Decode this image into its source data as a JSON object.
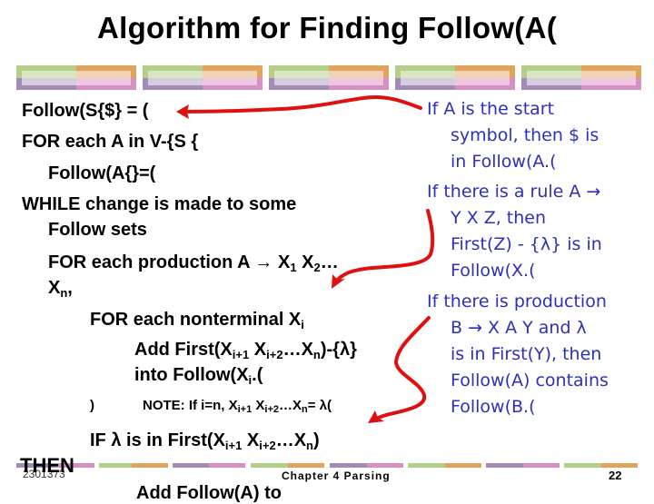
{
  "slide": {
    "title": "Algorithm for Finding Follow(A(",
    "colors": {
      "green": "#b4cf8a",
      "orange": "#e0a45e",
      "purple": "#a08cb4",
      "pink": "#d690c4",
      "arrow_red": "#e01010",
      "note_blue": "#2e30b8"
    },
    "algorithm": {
      "l1": "Follow(S{$} = (",
      "l2": "FOR each A in V-{S {",
      "l3": "Follow(A{}=(",
      "l4": "WHILE change is made to some",
      "l5": "Follow sets",
      "l6a": "FOR each production A ",
      "l6arrow": "→",
      "l6b": " X",
      "l6s1": "1",
      "l6c": " X",
      "l6s2": "2",
      "l6d": "…",
      "l7a": "X",
      "l7s": "n",
      "l7b": ",",
      "l8a": "FOR each nonterminal X",
      "l8s": "i",
      "l9a": "Add First(X",
      "l9s1": "i+1",
      "l9b": " X",
      "l9s2": "i+2",
      "l9c": "…X",
      "l9s3": "n",
      "l9d": ")-{λ}",
      "l10a": "into Follow(X",
      "l10s": "i",
      "l10b": ".(",
      "note_paren": ")",
      "note_a": "NOTE: If i=n, X",
      "note_s1": "i+1",
      "note_b": " X",
      "note_s2": "i+2",
      "note_c": "…X",
      "note_s3": "n",
      "note_d": "= λ(",
      "l12a": "IF λ is in First(X",
      "l12s1": "i+1",
      "l12b": " X",
      "l12s2": "i+2",
      "l12c": "…X",
      "l12s3": "n",
      "l12d": ")",
      "l13": "THEN",
      "l14": "Add Follow(A) to"
    },
    "rules": [
      "If A is the start",
      "symbol, then $ is",
      "in Follow(A.(",
      "If there is a rule A →",
      "Y X Z, then",
      "First(Z) - {λ} is in",
      "Follow(X.(",
      "If there is production",
      "B → X A Y and λ",
      "is in First(Y), then",
      "Follow(A) contains",
      "Follow(B.("
    ],
    "footer": {
      "course": "2301373",
      "chapter": "Chapter 4  Parsing",
      "page": "22"
    }
  }
}
